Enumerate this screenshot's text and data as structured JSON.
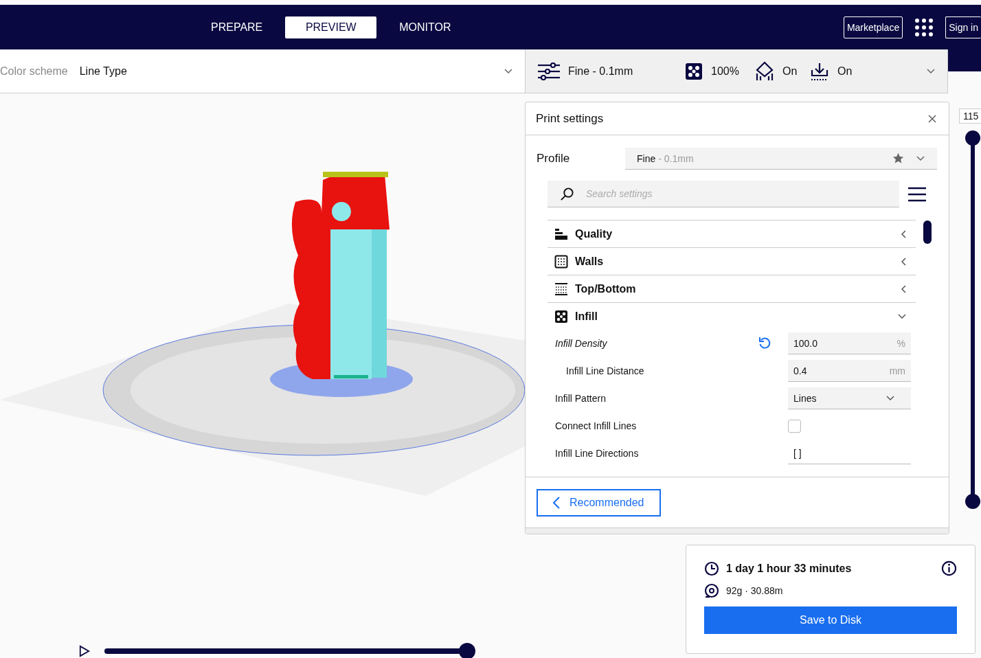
{
  "header": {
    "tabs": [
      {
        "label": "PREPARE",
        "selected": false
      },
      {
        "label": "PREVIEW",
        "selected": true
      },
      {
        "label": "MONITOR",
        "selected": false
      }
    ],
    "marketplace": "Marketplace",
    "sign_in": "Sign in"
  },
  "view_bar": {
    "label": "Color scheme",
    "value": "Line Type"
  },
  "settings_bar": {
    "profile": "Fine - 0.1mm",
    "infill": "100%",
    "support": "On",
    "adhesion": "On"
  },
  "print_settings": {
    "title": "Print settings",
    "profile_label": "Profile",
    "profile_name": "Fine",
    "profile_detail": "- 0.1mm",
    "search_placeholder": "Search settings",
    "categories": [
      {
        "kind": "quality",
        "label": "Quality",
        "expanded": false
      },
      {
        "kind": "walls",
        "label": "Walls",
        "expanded": false
      },
      {
        "kind": "topbottom",
        "label": "Top/Bottom",
        "expanded": false
      },
      {
        "kind": "infill",
        "label": "Infill",
        "expanded": true,
        "settings": [
          {
            "kind": "number",
            "label": "Infill Density",
            "value": "100.0",
            "unit": "%",
            "modified": true,
            "children": [
              {
                "kind": "number",
                "label": "Infill Line Distance",
                "value": "0.4",
                "unit": "mm",
                "modified": false
              }
            ]
          },
          {
            "kind": "select",
            "label": "Infill Pattern",
            "value": "Lines",
            "modified": false
          },
          {
            "kind": "checkbox",
            "label": "Connect Infill Lines",
            "checked": false,
            "modified": false
          },
          {
            "kind": "text",
            "label": "Infill Line Directions",
            "value": "[ ]",
            "modified": false
          }
        ]
      }
    ],
    "recommended_button": "Recommended"
  },
  "layer_slider": {
    "label": "115",
    "level": 1
  },
  "estimate": {
    "time": "1 day 1 hour 33 minutes",
    "material": "92g · 30.88m",
    "save_button": "Save to Disk"
  },
  "playback": {
    "level": 1
  }
}
